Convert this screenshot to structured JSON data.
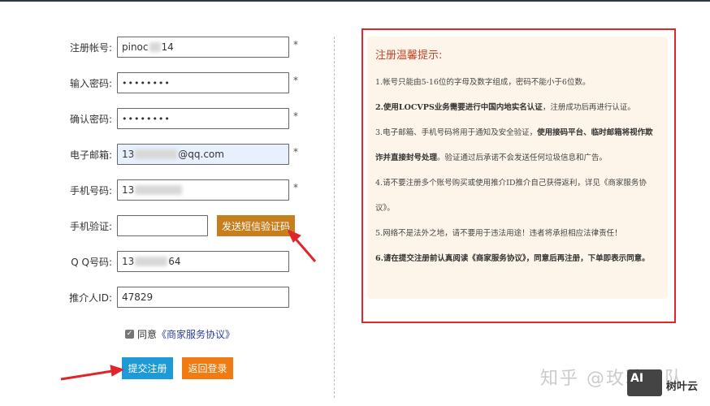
{
  "form": {
    "username": {
      "label": "注册帐号:",
      "value_start": "pinoc",
      "value_end": "14"
    },
    "password": {
      "label": "输入密码:",
      "value": "••••••••"
    },
    "confirm": {
      "label": "确认密码:",
      "value": "••••••••"
    },
    "email": {
      "label": "电子邮箱:",
      "value_start": "13",
      "value_end": "@qq.com"
    },
    "phone": {
      "label": "手机号码:",
      "value_start": "13"
    },
    "sms": {
      "label": "手机验证:",
      "value": "",
      "button": "发送短信验证码"
    },
    "qq": {
      "label": "Q Q号码:",
      "value_start": "13",
      "value_end": "64"
    },
    "referrer": {
      "label": "推介人ID:",
      "value": "47829"
    },
    "required": "*",
    "agree_text": "同意",
    "agree_link": "《商家服务协议》",
    "submit": "提交注册",
    "back": "返回登录"
  },
  "notice": {
    "title": "注册温馨提示:",
    "items": [
      {
        "plain": "1.帐号只能由5-16位的字母及数字组成，密码不能小于6位数。"
      },
      {
        "bold": "2.使用LOCVPS业务需要进行中国内地实名认证",
        "plain": "，注册成功后再进行认证。"
      },
      {
        "plain": "3.电子邮箱、手机号码将用于通知及安全验证，",
        "bold": "使用接码平台、临时邮箱将视作欺诈并直接封号处理",
        "plain2": "。验证通过后承诺不会发送任何垃圾信息和广告。"
      },
      {
        "plain": "4.请不要注册多个账号购买或使用推介ID推介自己获得返利，详见《商家服务协议》。"
      },
      {
        "plain": "5.网络不是法外之地，请不要用于违法用途！违者将承担相应法律责任！"
      },
      {
        "bold": "6.请在提交注册前认真阅读《商家服务协议》，同意后再注册，下单即表示同意。"
      }
    ]
  },
  "watermark": {
    "text": "知乎 @玫瑰团队",
    "logo": "AI",
    "brand": "树叶云"
  },
  "colors": {
    "sms": "#c67f1c",
    "submit": "#1e9ad6",
    "back": "#f07b12",
    "border": "#e0262a"
  }
}
